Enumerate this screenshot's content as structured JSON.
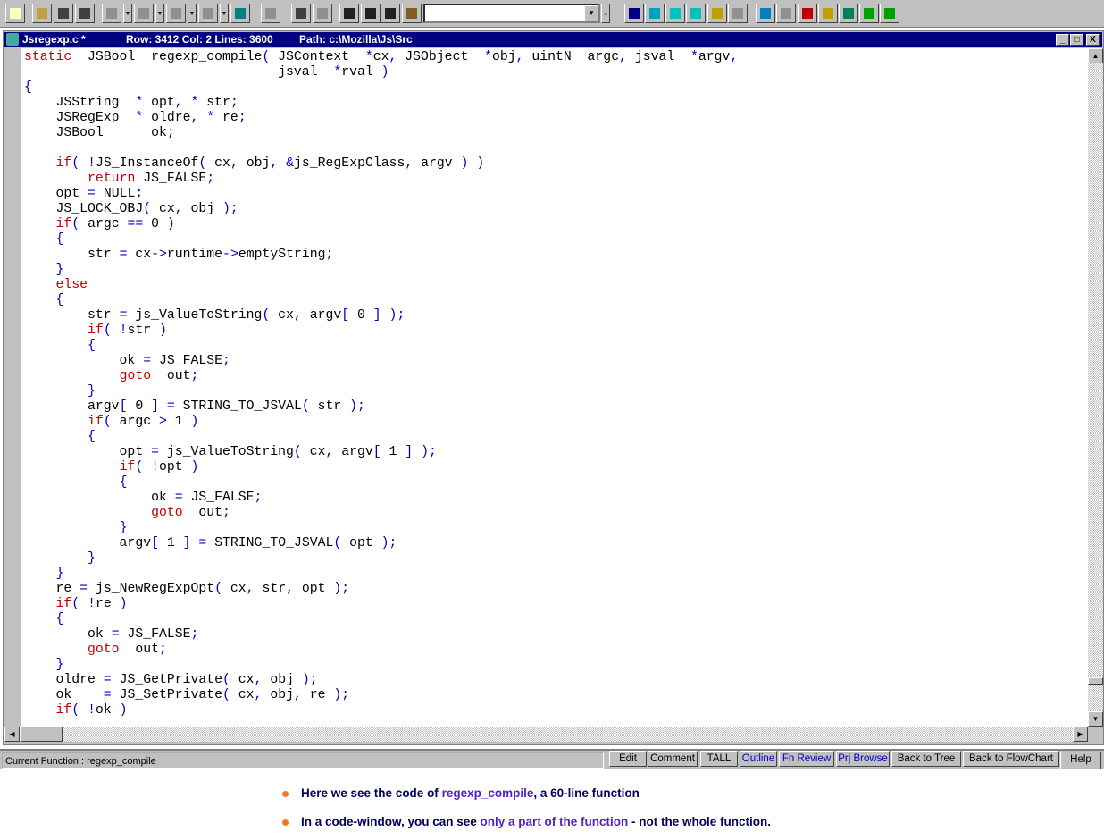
{
  "toolbar": {
    "icons": [
      "new-file-icon",
      "open-folder-icon",
      "save-icon",
      "save-all-icon",
      "cut-icon",
      "copy-icon",
      "delete-icon",
      "paste-icon",
      "spell-check-icon",
      "spell-check-all-icon",
      "undo-icon",
      "redo-icon",
      "find-up-icon",
      "find-down-icon",
      "find-icon",
      "find-in-files-icon"
    ],
    "right_icons": [
      "brace-match-icon",
      "cascade-windows-icon",
      "tile-vertical-icon",
      "tile-horizontal-icon",
      "compare-icon",
      "merge-icon",
      "flowchart-icon",
      "structure-icon",
      "call-tree-icon",
      "hierarchy-icon",
      "document-icon",
      "report-icon",
      "stack-icon"
    ],
    "search_value": ""
  },
  "window": {
    "filename": "Jsregexp.c *",
    "position": "Row: 3412 Col: 2  Lines: 3600",
    "path": "Path: c:\\Mozilla\\Js\\Src",
    "minimize": "_",
    "maximize": "□",
    "close": "X"
  },
  "code": {
    "lines": [
      "static  JSBool  regexp_compile( JSContext  *cx, JSObject  *obj, uintN  argc, jsval  *argv,",
      "                                jsval  *rval )",
      "{",
      "    JSString  * opt, * str;",
      "    JSRegExp  * oldre, * re;",
      "    JSBool      ok;",
      "",
      "    if( !JS_InstanceOf( cx, obj, &js_RegExpClass, argv ) )",
      "        return JS_FALSE;",
      "    opt = NULL;",
      "    JS_LOCK_OBJ( cx, obj );",
      "    if( argc == 0 )",
      "    {",
      "        str = cx->runtime->emptyString;",
      "    }",
      "    else",
      "    {",
      "        str = js_ValueToString( cx, argv[ 0 ] );",
      "        if( !str )",
      "        {",
      "            ok = JS_FALSE;",
      "            goto  out;",
      "        }",
      "        argv[ 0 ] = STRING_TO_JSVAL( str );",
      "        if( argc > 1 )",
      "        {",
      "            opt = js_ValueToString( cx, argv[ 1 ] );",
      "            if( !opt )",
      "            {",
      "                ok = JS_FALSE;",
      "                goto  out;",
      "            }",
      "            argv[ 1 ] = STRING_TO_JSVAL( opt );",
      "        }",
      "    }",
      "    re = js_NewRegExpOpt( cx, str, opt );",
      "    if( !re )",
      "    {",
      "        ok = JS_FALSE;",
      "        goto  out;",
      "    }",
      "    oldre = JS_GetPrivate( cx, obj );",
      "    ok    = JS_SetPrivate( cx, obj, re );",
      "    if( !ok )"
    ],
    "keywords": [
      "static",
      "if",
      "return",
      "else",
      "goto"
    ]
  },
  "status": {
    "current_function": "Current Function :  regexp_compile",
    "buttons": [
      "Edit",
      "Comment",
      "TALL",
      "Outline",
      "Fn Review",
      "Prj Browse",
      "Back to Tree",
      "Back to FlowChart",
      "Help"
    ]
  },
  "caption": [
    {
      "pre": "Here we see the code of ",
      "hl": "regexp_compile",
      "post": ", a 60-line function"
    },
    {
      "pre": "In a code-window, you can see ",
      "hl": "only a part of the function",
      "post": " - not the whole function."
    }
  ],
  "colors": {
    "keyword": "#c00000",
    "punctuation": "#0000c0",
    "titlebar": "#000080",
    "bullet": "#f07830"
  }
}
